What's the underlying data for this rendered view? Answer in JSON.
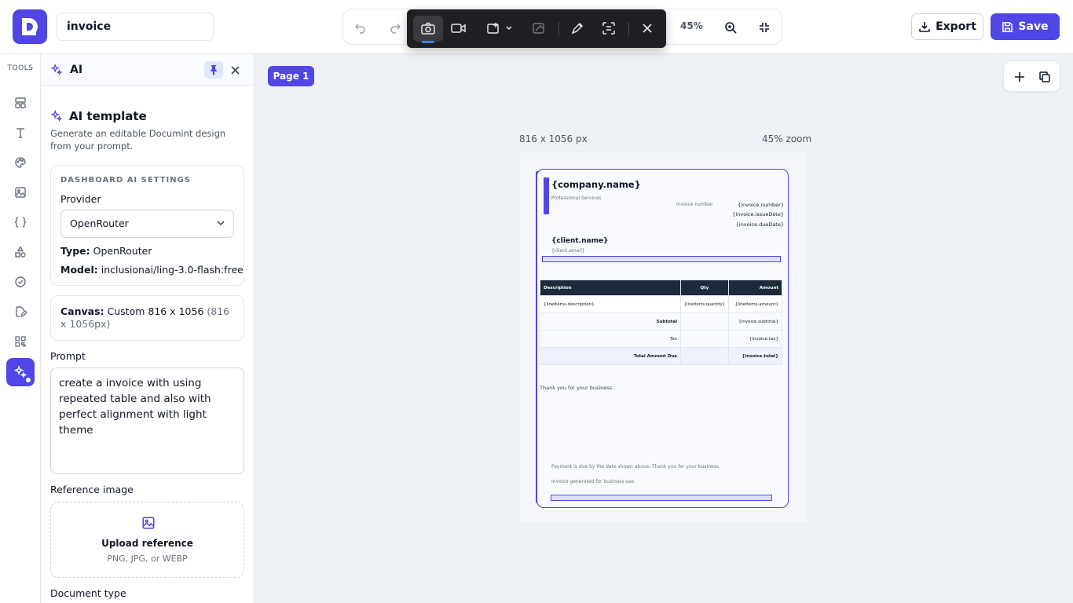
{
  "app": {
    "doc_name": "invoice"
  },
  "toolbar": {
    "zoom": "45%",
    "export_label": "Export",
    "save_label": "Save"
  },
  "rail": {
    "tools_label": "TOOLS"
  },
  "panel": {
    "title": "AI",
    "section_title": "AI template",
    "section_desc": "Generate an editable Documint design from your prompt.",
    "settings_caption": "DASHBOARD AI SETTINGS",
    "provider_label": "Provider",
    "provider_value": "OpenRouter",
    "type_label": "Type:",
    "type_value": "OpenRouter",
    "model_label": "Model:",
    "model_value": "inclusionai/ling-3.0-flash:free",
    "canvas_label": "Canvas:",
    "canvas_value": "Custom 816 x 1056",
    "canvas_px": "(816 x 1056px)",
    "prompt_label": "Prompt",
    "prompt_value": "create a invoice with using repeated table and also with perfect alignment with light theme",
    "ref_label": "Reference image",
    "upload_title": "Upload reference",
    "upload_hint": "PNG, JPG, or WEBP",
    "doctype_label": "Document type"
  },
  "canvas": {
    "page_badge": "Page 1",
    "size_text": "816 x 1056 px",
    "zoom_text": "45% zoom"
  },
  "invoice": {
    "company": "{company.name}",
    "tagline": "Professional Services",
    "invoice_number_label": "Invoice number",
    "number": "{invoice.number}",
    "issue_date": "{invoice.issueDate}",
    "due_date": "{invoice.dueDate}",
    "client_name": "{client.name}",
    "client_email": "{client.email}",
    "table": {
      "headers": [
        "Description",
        "Qty",
        "Amount"
      ],
      "row": [
        "{lineItems.description}",
        "{lineItems.quantity}",
        "{lineItems.amount}"
      ],
      "subtotal_label": "Subtotal",
      "subtotal_value": "{invoice.subtotal}",
      "tax_label": "Tax",
      "tax_value": "{invoice.tax}",
      "total_label": "Total Amount Due",
      "total_value": "{invoice.total}"
    },
    "thanks": "Thank you for your business.",
    "footer_note": "Payment is due by the date shown above. Thank you for your business.",
    "footer_note2": "Invoice generated for business use"
  },
  "colors": {
    "accent": "#4f46e5",
    "table_header": "#1e293b"
  }
}
